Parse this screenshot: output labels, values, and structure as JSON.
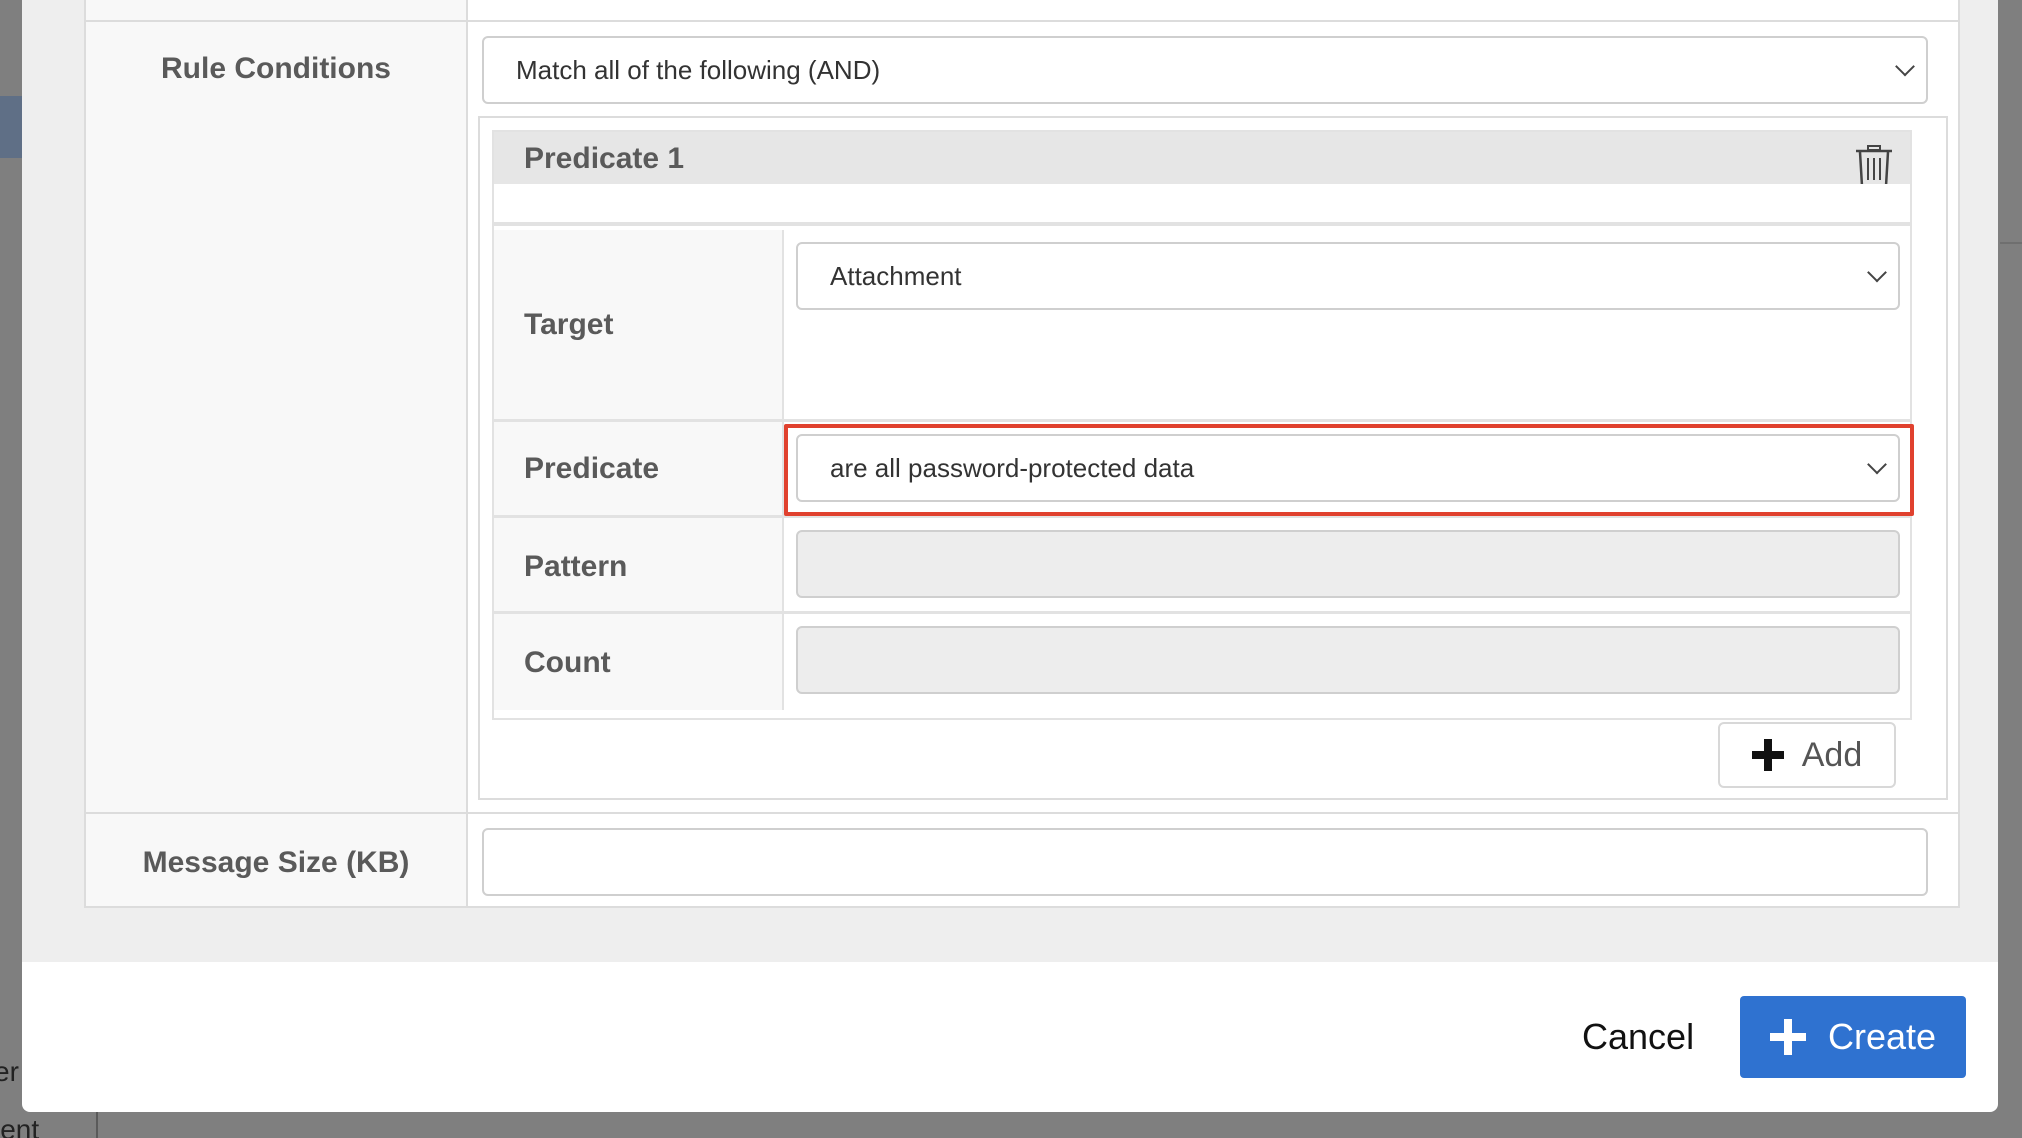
{
  "form": {
    "rule_conditions_label": "Rule Conditions",
    "match_select_value": "Match all of the following (AND)",
    "message_size_label": "Message Size (KB)",
    "message_size_value": ""
  },
  "predicate": {
    "title": "Predicate 1",
    "target_label": "Target",
    "target_value": "Attachment",
    "predicate_label": "Predicate",
    "predicate_value": "are all password-protected data",
    "pattern_label": "Pattern",
    "pattern_value": "",
    "count_label": "Count",
    "count_value": "",
    "add_label": "Add"
  },
  "footer": {
    "cancel_label": "Cancel",
    "create_label": "Create"
  },
  "background": {
    "left_text_1": "er",
    "left_text_2": "ient"
  },
  "icons": {
    "trash": "trash-icon",
    "chevron": "chevron-down-icon",
    "plus": "plus-icon"
  },
  "colors": {
    "primary": "#2f72d0",
    "highlight": "#e0412e"
  }
}
